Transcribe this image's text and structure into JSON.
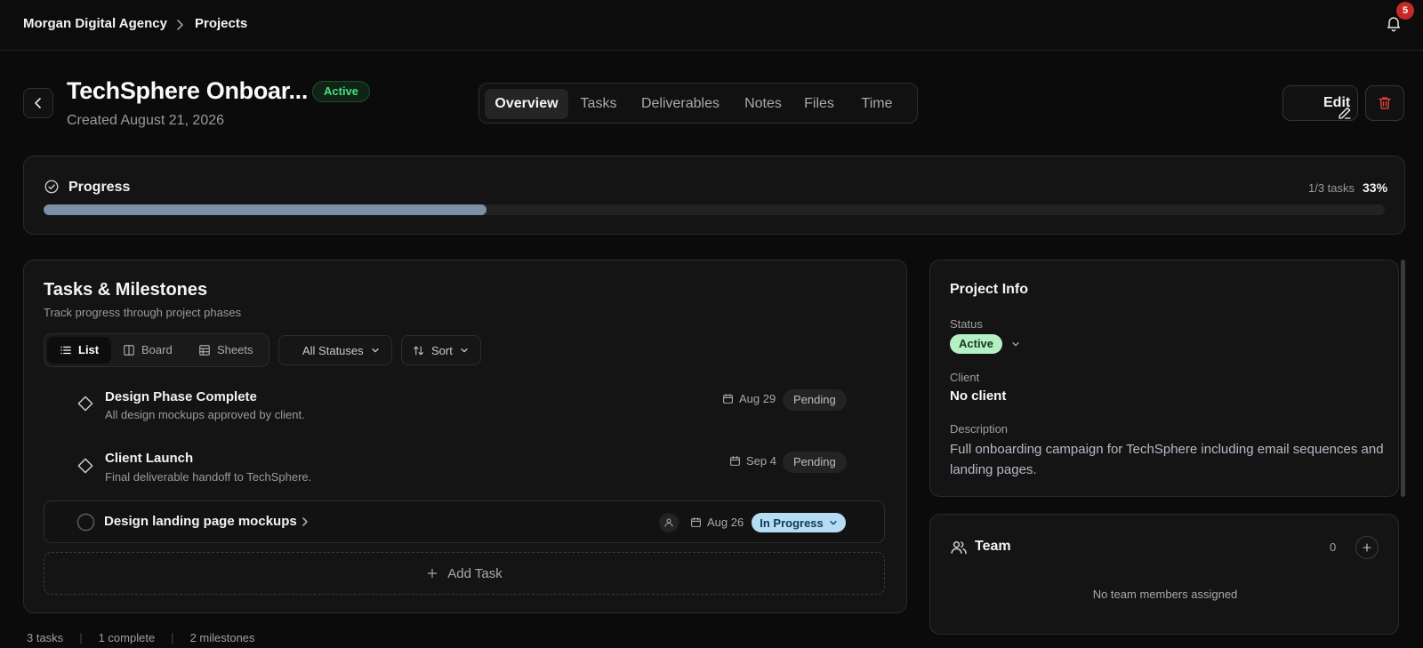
{
  "breadcrumb": {
    "agency": "Morgan Digital Agency",
    "current": "Projects"
  },
  "notifications": {
    "count": "5"
  },
  "project": {
    "title": "TechSphere Onboar...",
    "status": "Active",
    "created": "Created August 21, 2026"
  },
  "tabs": [
    {
      "label": "Overview",
      "active": true
    },
    {
      "label": "Tasks"
    },
    {
      "label": "Deliverables"
    },
    {
      "label": "Notes"
    },
    {
      "label": "Files"
    },
    {
      "label": "Time"
    }
  ],
  "actions": {
    "edit": "Edit"
  },
  "progress": {
    "title": "Progress",
    "tasks": "1/3 tasks",
    "percent": "33%",
    "fraction": 0.33
  },
  "tasks": {
    "title": "Tasks & Milestones",
    "subtitle": "Track progress through project phases",
    "views": [
      "List",
      "Board",
      "Sheets"
    ],
    "filter": "All Statuses",
    "sort": "Sort",
    "milestones": [
      {
        "title": "Design Phase Complete",
        "desc": "All design mockups approved by client.",
        "date": "Aug 29",
        "status": "Pending"
      },
      {
        "title": "Client Launch",
        "desc": "Final deliverable handoff to TechSphere.",
        "date": "Sep 4",
        "status": "Pending"
      }
    ],
    "task": {
      "title": "Design landing page mockups",
      "date": "Aug 26",
      "status": "In Progress"
    },
    "add": "Add Task"
  },
  "footer": {
    "tasks": "3 tasks",
    "complete": "1 complete",
    "milestones": "2 milestones"
  },
  "info": {
    "title": "Project Info",
    "status_label": "Status",
    "status": "Active",
    "client_label": "Client",
    "client": "No client",
    "description_label": "Description",
    "description": "Full onboarding campaign for TechSphere including email sequences and landing pages."
  },
  "team": {
    "title": "Team",
    "count": "0",
    "empty": "No team members assigned"
  },
  "colors": {
    "accent": "#7d8ea8",
    "active_green": "#4ade80",
    "in_progress": "#b6dcf4",
    "danger": "#ef4444"
  },
  "icons": [
    "chevron-right-icon",
    "bell-icon",
    "chevron-left-icon",
    "pencil-icon",
    "trash-icon",
    "check-circle-icon",
    "list-icon",
    "board-icon",
    "sheets-icon",
    "chevron-down-icon",
    "sort-icon",
    "diamond-icon",
    "calendar-icon",
    "circle-icon",
    "user-icon",
    "plus-icon",
    "users-icon"
  ]
}
